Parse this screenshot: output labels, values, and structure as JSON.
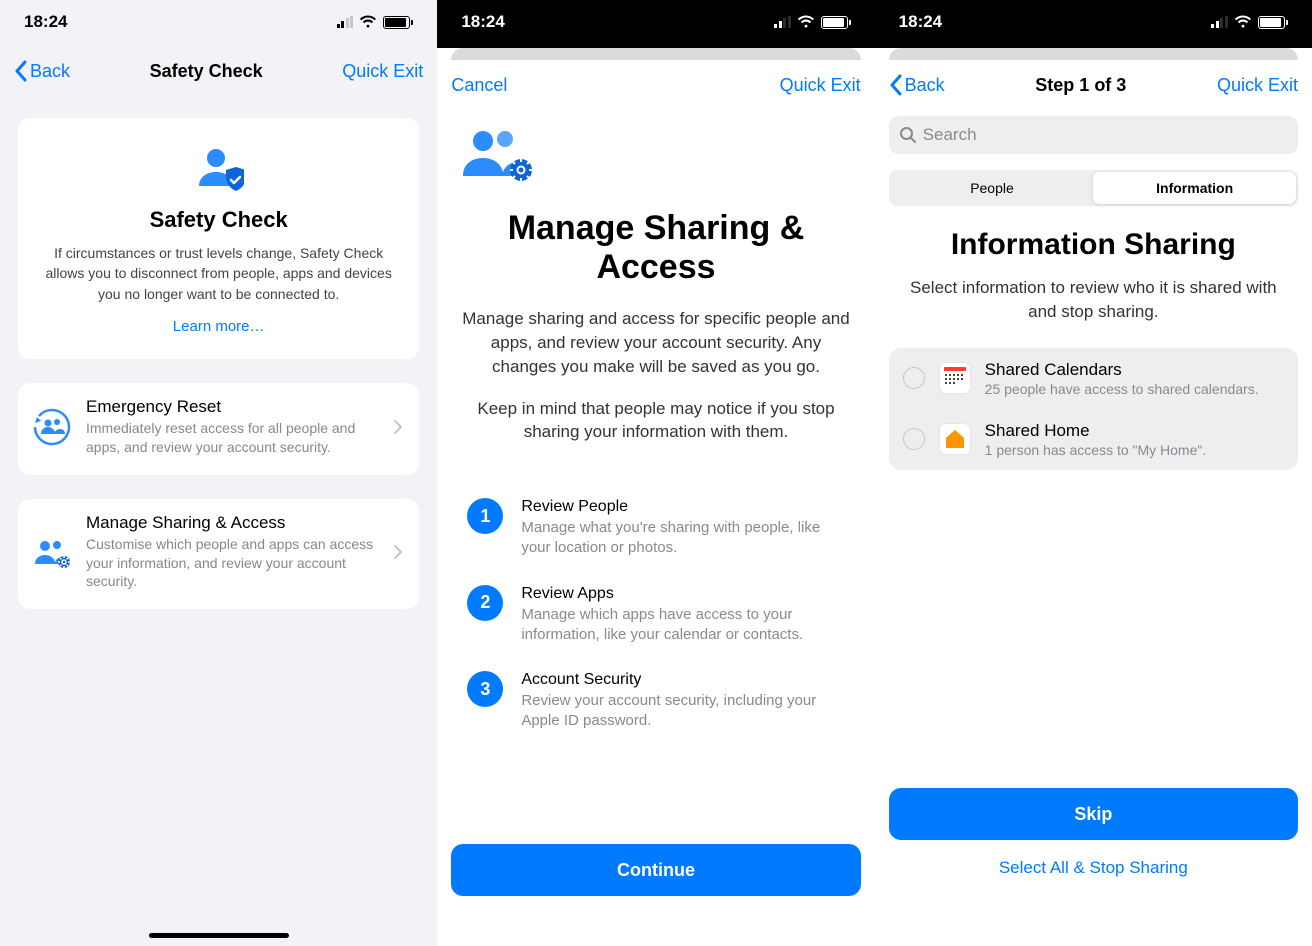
{
  "status": {
    "time": "18:24"
  },
  "colors": {
    "accent": "#007aff"
  },
  "screen1": {
    "nav": {
      "back": "Back",
      "title": "Safety Check",
      "quick_exit": "Quick Exit"
    },
    "hero": {
      "title": "Safety Check",
      "desc": "If circumstances or trust levels change, Safety Check allows you to disconnect from people, apps and devices you no longer want to be connected to.",
      "learn_more": "Learn more…"
    },
    "emergency": {
      "title": "Emergency Reset",
      "desc": "Immediately reset access for all people and apps, and review your account security."
    },
    "manage": {
      "title": "Manage Sharing & Access",
      "desc": "Customise which people and apps can access your information, and review your account security."
    }
  },
  "screen2": {
    "nav": {
      "cancel": "Cancel",
      "quick_exit": "Quick Exit"
    },
    "hero": {
      "title": "Manage Sharing & Access",
      "desc1": "Manage sharing and access for specific people and apps, and review your account security. Any changes you make will be saved as you go.",
      "desc2": "Keep in mind that people may notice if you stop sharing your information with them."
    },
    "steps": [
      {
        "n": "1",
        "title": "Review People",
        "desc": "Manage what you're sharing with people, like your location or photos."
      },
      {
        "n": "2",
        "title": "Review Apps",
        "desc": "Manage which apps have access to your information, like your calendar or contacts."
      },
      {
        "n": "3",
        "title": "Account Security",
        "desc": "Review your account security, including your Apple ID password."
      }
    ],
    "continue": "Continue"
  },
  "screen3": {
    "nav": {
      "back": "Back",
      "title": "Step 1 of 3",
      "quick_exit": "Quick Exit"
    },
    "search": {
      "placeholder": "Search"
    },
    "tabs": {
      "people": "People",
      "information": "Information"
    },
    "hero": {
      "title": "Information Sharing",
      "desc": "Select information to review who it is shared with and stop sharing."
    },
    "rows": [
      {
        "title": "Shared Calendars",
        "desc": "25 people have access to shared calendars."
      },
      {
        "title": "Shared Home",
        "desc": "1 person has access to \"My Home\"."
      }
    ],
    "skip": "Skip",
    "select_all": "Select All & Stop Sharing"
  }
}
